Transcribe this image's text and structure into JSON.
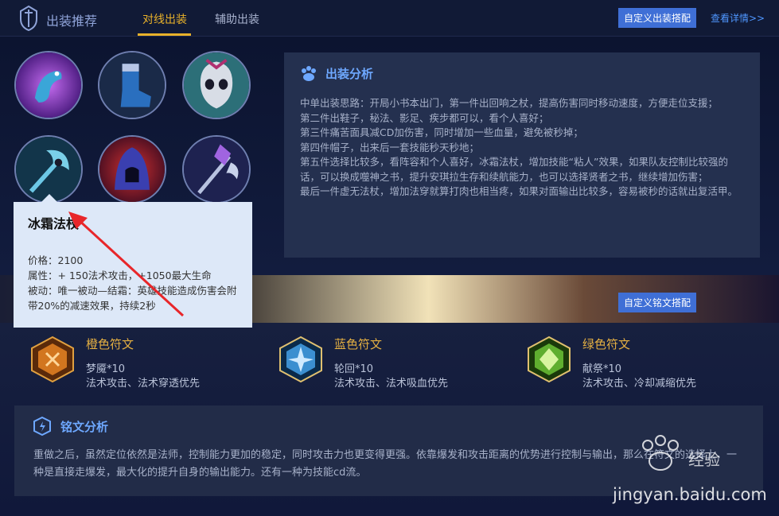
{
  "header": {
    "site_title": "出装推荐",
    "tabs": [
      {
        "label": "对线出装",
        "active": true
      },
      {
        "label": "辅助出装",
        "active": false
      }
    ],
    "custom_build_button": "自定义出装搭配",
    "more_link": "查看详情>>"
  },
  "items": [
    {
      "icon": "dragon-tome-icon",
      "color": "#8a3fd0"
    },
    {
      "icon": "boots-icon",
      "color": "#2a6fbf"
    },
    {
      "icon": "skull-mask-icon",
      "color": "#3aa6a8"
    },
    {
      "icon": "frost-staff-icon",
      "color": "#2a7e96"
    },
    {
      "icon": "hood-icon",
      "color": "#3a3fb0"
    },
    {
      "icon": "crystal-staff-icon",
      "color": "#5a4fbf"
    }
  ],
  "tooltip": {
    "name": "冰霜法杖",
    "price": "价格：2100",
    "attributes": "属性：+ 150法术攻击，+1050最大生命",
    "passive": "被动：唯一被动—结霜：英雄技能造成伤害会附带20%的减速效果，持续2秒"
  },
  "analysis": {
    "title": "出装分析",
    "text": "中单出装思路：开局小书本出门，第一件出回响之杖，提高伤害同时移动速度，方便走位支援；\n第二件出鞋子，秘法、影足、疾步都可以，看个人喜好；\n第三件痛苦面具减CD加伤害，同时增加一些血量，避免被秒掉；\n第四件帽子，出来后一套技能秒天秒地；\n第五件选择比较多，看阵容和个人喜好，冰霜法杖，增加技能“粘人”效果，如果队友控制比较强的话，可以换成噬神之书，提升安琪拉生存和续航能力，也可以选择贤者之书，继续增加伤害；\n最后一件虚无法杖，增加法穿就算打肉也相当疼，如果对面输出比较多，容易被秒的话就出复活甲。"
  },
  "runes": {
    "custom_button": "自定义铭文搭配",
    "list": [
      {
        "title": "橙色符文",
        "name": "梦魇*10",
        "desc": "法术攻击、法术穿透优先",
        "icon": "orange-rune-icon",
        "color": "#d2761f"
      },
      {
        "title": "蓝色符文",
        "name": "轮回*10",
        "desc": "法术攻击、法术吸血优先",
        "icon": "blue-rune-icon",
        "color": "#3b8fd0"
      },
      {
        "title": "绿色符文",
        "name": "献祭*10",
        "desc": "法术攻击、冷却减缩优先",
        "icon": "green-rune-icon",
        "color": "#5fae2f"
      }
    ]
  },
  "rune_analysis": {
    "title": "铭文分析",
    "text": "重做之后，虽然定位依然是法师，控制能力更加的稳定，同时攻击力也更变得更强。依靠爆发和攻击距离的优势进行控制与输出，那么在符文的选择上，一种是直接走爆发，最大化的提升自身的输出能力。还有一种为技能cd流。"
  },
  "watermark": {
    "brand": "经验",
    "url": "jingyan.baidu.com"
  },
  "colors": {
    "accent_tab": "#e9b22a",
    "button_blue": "#3f6fd6",
    "heading_blue": "#6ea8ff"
  }
}
